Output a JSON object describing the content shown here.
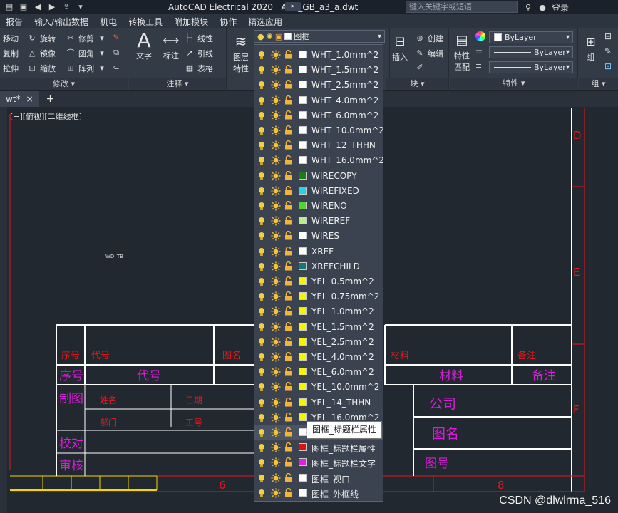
{
  "titlebar": {
    "app_title": "AutoCAD Electrical 2020",
    "file_name": "ACE_GB_a3_a.dwt",
    "search_placeholder": "键入关键字或短语",
    "login_label": "登录"
  },
  "menu_tabs": [
    "报告",
    "输入/输出数据",
    "机电",
    "转换工具",
    "附加模块",
    "协作",
    "精选应用"
  ],
  "ribbon": {
    "modify": {
      "title": "修改",
      "items": [
        "移动",
        "旋转",
        "修剪",
        "复制",
        "镜像",
        "圆角",
        "拉伸",
        "缩放",
        "阵列"
      ]
    },
    "annotation": {
      "title": "注释",
      "big_text": "文字",
      "big_dim": "标注",
      "items": [
        "线性",
        "引线",
        "表格"
      ]
    },
    "layers": {
      "big_label_1": "图层",
      "big_label_2": "特性",
      "current_layer": "图框"
    },
    "block": {
      "title": "块",
      "insert": "插入",
      "items": [
        "创建",
        "编辑"
      ]
    },
    "properties": {
      "title": "特性",
      "match_1": "特性",
      "match_2": "匹配",
      "color": "ByLayer",
      "linetype": "ByLayer",
      "lineweight": "ByLayer"
    },
    "groups": {
      "title": "组",
      "big": "组"
    }
  },
  "doc_tab": {
    "label": "wt*",
    "close": "×",
    "new_tab": "+"
  },
  "view_label": "[−][俯视][二维线框]",
  "drawing": {
    "wd_tb": "WD_TB",
    "zone_letters": [
      "D",
      "E",
      "F"
    ],
    "column_numbers": [
      "6",
      "8"
    ],
    "row1_red": [
      "序号",
      "代号",
      "图名",
      "材料",
      "备注"
    ],
    "row2_magenta": [
      "序号",
      "代号",
      "材料",
      "备注"
    ],
    "left_block_magenta": [
      "制图",
      "校对",
      "审核"
    ],
    "left_block_red": [
      "姓名",
      "日期",
      "部门",
      "工号"
    ],
    "right_block_magenta": [
      "公司",
      "图名",
      "图号"
    ]
  },
  "layer_list": [
    {
      "name": "WHT_1.0mm^2",
      "color": "#ffffff"
    },
    {
      "name": "WHT_1.5mm^2",
      "color": "#ffffff"
    },
    {
      "name": "WHT_2.5mm^2",
      "color": "#ffffff"
    },
    {
      "name": "WHT_4.0mm^2",
      "color": "#ffffff"
    },
    {
      "name": "WHT_6.0mm^2",
      "color": "#ffffff"
    },
    {
      "name": "WHT_10.0mm^2",
      "color": "#ffffff"
    },
    {
      "name": "WHT_12_THHN",
      "color": "#ffffff"
    },
    {
      "name": "WHT_16.0mm^2",
      "color": "#ffffff"
    },
    {
      "name": "WIRECOPY",
      "color": "#1c7a1c"
    },
    {
      "name": "WIREFIXED",
      "color": "#22d6e6"
    },
    {
      "name": "WIRENO",
      "color": "#4ed92c"
    },
    {
      "name": "WIREREF",
      "color": "#b8ee8a"
    },
    {
      "name": "WIRES",
      "color": "#ffffff"
    },
    {
      "name": "XREF",
      "color": "#ffffff"
    },
    {
      "name": "XREFCHILD",
      "color": "#137a73"
    },
    {
      "name": "YEL_0.5mm^2",
      "color": "#f5f500"
    },
    {
      "name": "YEL_0.75mm^2",
      "color": "#f5f500"
    },
    {
      "name": "YEL_1.0mm^2",
      "color": "#f5f500"
    },
    {
      "name": "YEL_1.5mm^2",
      "color": "#f5f500"
    },
    {
      "name": "YEL_2.5mm^2",
      "color": "#f5f500"
    },
    {
      "name": "YEL_4.0mm^2",
      "color": "#f5f500"
    },
    {
      "name": "YEL_6.0mm^2",
      "color": "#f5f500"
    },
    {
      "name": "YEL_10.0mm^2",
      "color": "#f5f500"
    },
    {
      "name": "YEL_14_THHN",
      "color": "#f5f500"
    },
    {
      "name": "YEL_16.0mm^2",
      "color": "#f5f500"
    },
    {
      "name": "图框",
      "color": "#ffffff"
    },
    {
      "name": "图框_标题栏属性",
      "color": "#e01010"
    },
    {
      "name": "图框_标题栏文字",
      "color": "#e020e0"
    },
    {
      "name": "图框_视口",
      "color": "#ffffff"
    },
    {
      "name": "图框_外框线",
      "color": "#ffffff"
    }
  ],
  "tooltip": "图框_标题栏属性",
  "watermark": "CSDN @dlwlrma_516",
  "colors": {
    "accent_red": "#e21a1a",
    "accent_magenta": "#d61fd6",
    "frame_yellow": "#f5d400",
    "canvas_bg": "#212830"
  }
}
